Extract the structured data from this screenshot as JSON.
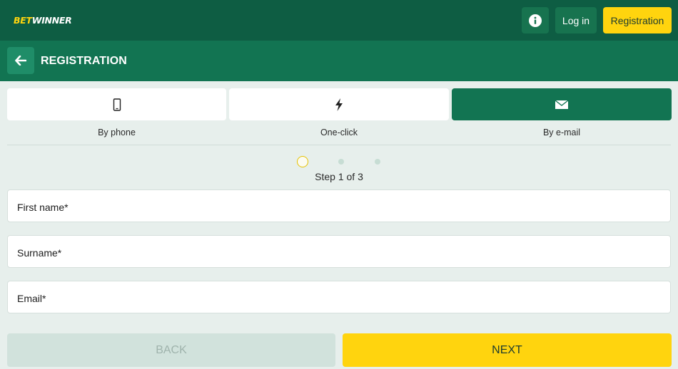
{
  "header": {
    "logo_part1": "BET",
    "logo_part2": "WINNER",
    "info_icon": "info-icon",
    "login_label": "Log in",
    "register_label": "Registration"
  },
  "subheader": {
    "back_icon": "arrow-left-icon",
    "title": "REGISTRATION"
  },
  "methods": [
    {
      "label": "By phone",
      "icon": "phone-icon",
      "active": false
    },
    {
      "label": "One-click",
      "icon": "lightning-icon",
      "active": false
    },
    {
      "label": "By e-mail",
      "icon": "envelope-icon",
      "active": true
    }
  ],
  "steps": {
    "current": 1,
    "total": 3,
    "text": "Step 1 of 3"
  },
  "form": {
    "first_name_label": "First name*",
    "surname_label": "Surname*",
    "email_label": "Email*"
  },
  "footer": {
    "back_label": "BACK",
    "next_label": "NEXT"
  },
  "colors": {
    "header_bg": "#0e5d43",
    "subheader_bg": "#127452",
    "accent_yellow": "#ffd40e",
    "page_bg": "#e7efec"
  }
}
